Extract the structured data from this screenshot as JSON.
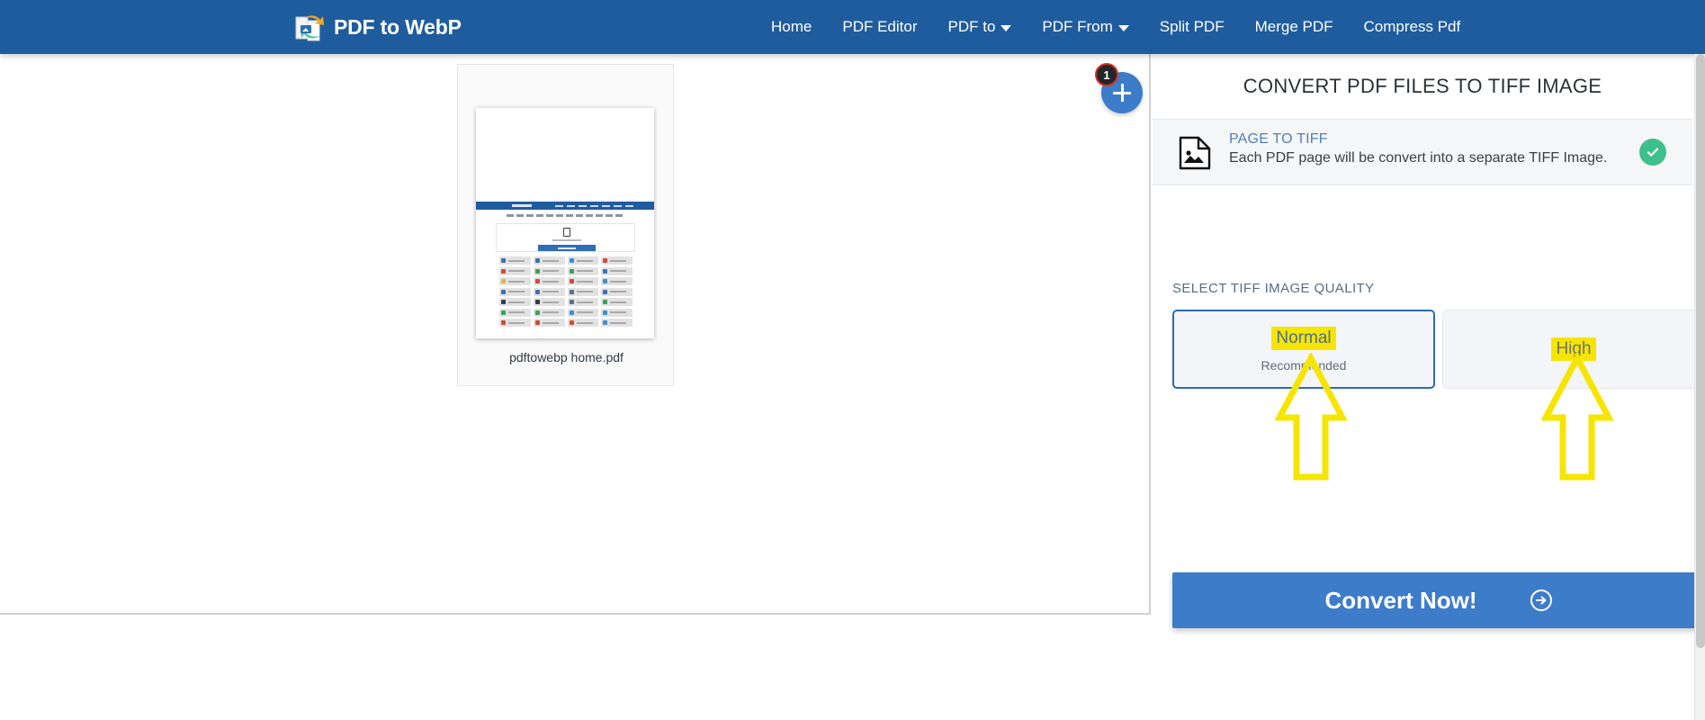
{
  "header": {
    "brand": "PDF to WebP",
    "brand_icon": "pdf-convert-logo-icon",
    "bg_color": "#1f5c9e",
    "nav": [
      {
        "label": "Home",
        "has_caret": false
      },
      {
        "label": "PDF Editor",
        "has_caret": false
      },
      {
        "label": "PDF to",
        "has_caret": true
      },
      {
        "label": "PDF From",
        "has_caret": true
      },
      {
        "label": "Split PDF",
        "has_caret": false
      },
      {
        "label": "Merge PDF",
        "has_caret": false
      },
      {
        "label": "Compress Pdf",
        "has_caret": false
      }
    ]
  },
  "workspace": {
    "file": {
      "name": "pdftowebp home.pdf"
    },
    "add_button": {
      "icon": "plus-icon",
      "badge_count": "1"
    }
  },
  "panel": {
    "title": "CONVERT PDF FILES TO TIFF IMAGE",
    "mode_option": {
      "icon": "image-file-icon",
      "title": "PAGE TO TIFF",
      "description": "Each PDF page will be convert into a separate TIFF Image.",
      "selected": true,
      "check_icon": "check-circle-icon",
      "check_color": "#3ec08a"
    },
    "quality": {
      "section_label": "SELECT TIFF IMAGE QUALITY",
      "options": [
        {
          "name": "Normal",
          "sub": "Recommended",
          "selected": true,
          "highlighted": true
        },
        {
          "name": "High",
          "sub": "",
          "selected": false,
          "highlighted": true
        }
      ],
      "selected_border_color": "#2d6cad",
      "highlight_color": "#f6e500"
    },
    "convert_button": {
      "label": "Convert Now!",
      "icon": "arrow-right-circle-icon",
      "color": "#3d7cc9"
    }
  },
  "annotations": {
    "color": "#f6e500",
    "arrows": [
      {
        "points_to": "Normal",
        "direction": "up"
      },
      {
        "points_to": "High",
        "direction": "up"
      }
    ]
  }
}
